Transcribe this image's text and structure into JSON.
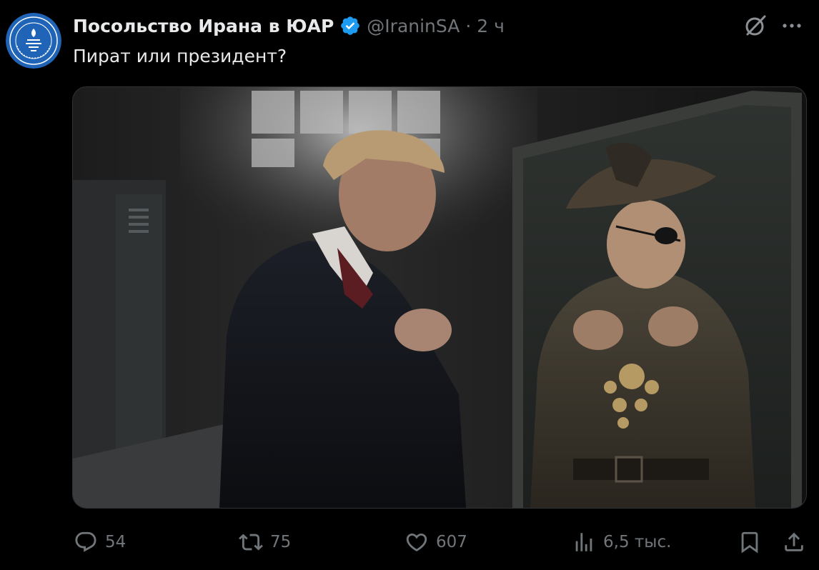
{
  "tweet": {
    "author": {
      "display_name": "Посольство Ирана в ЮАР",
      "handle": "@IraninSA",
      "verified": true,
      "avatar_icon": "embassy-seal-icon"
    },
    "separator": "·",
    "time": "2 ч",
    "text": "Пират или президент?",
    "media": {
      "type": "video-thumbnail",
      "icon": "media-image"
    },
    "metrics": {
      "replies": "54",
      "reposts": "75",
      "likes": "607",
      "views": "6,5 тыс."
    }
  },
  "icons": {
    "grok": "grok-icon",
    "more": "more-icon",
    "reply": "reply-icon",
    "repost": "repost-icon",
    "like": "heart-icon",
    "views": "views-chart-icon",
    "bookmark": "bookmark-icon",
    "share": "share-icon"
  },
  "colors": {
    "background": "#000000",
    "text_primary": "#e7e9ea",
    "text_secondary": "#71767b",
    "verified_blue": "#1d9bf0",
    "avatar_blue": "#1f64b6",
    "border": "#2f3336"
  }
}
